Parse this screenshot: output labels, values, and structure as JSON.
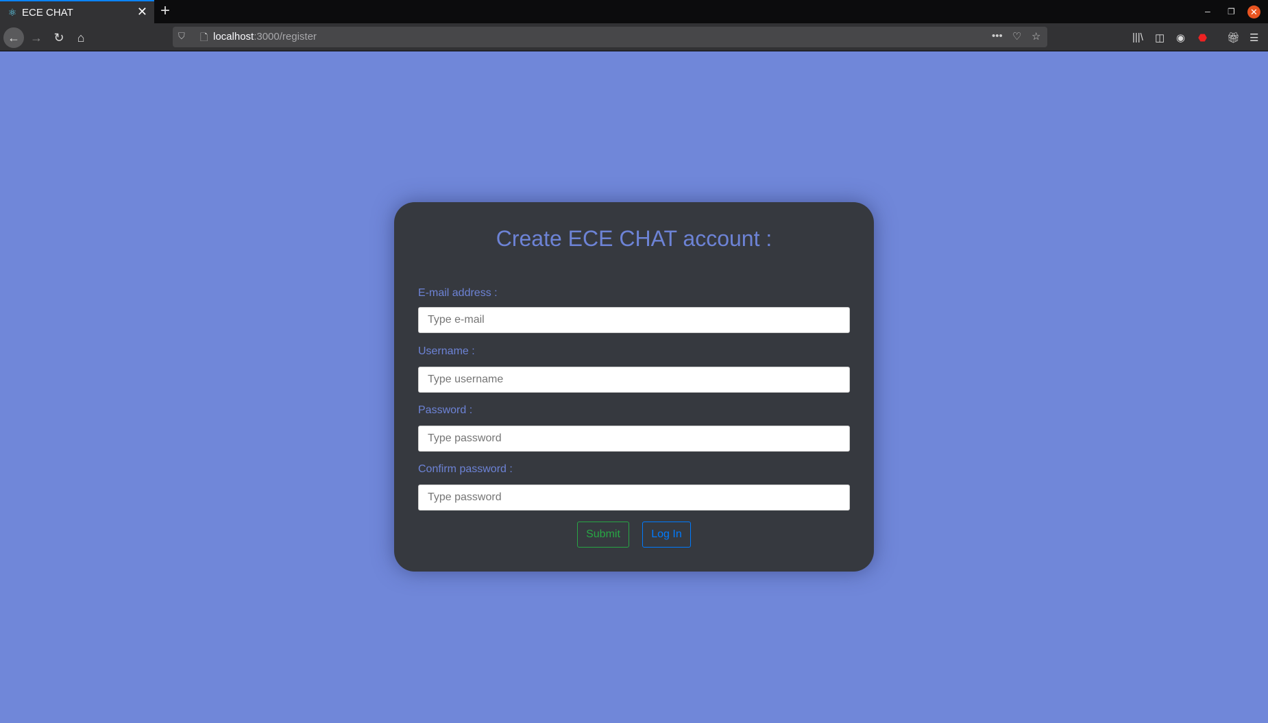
{
  "browser": {
    "tab_title": "ECE CHAT",
    "url_host": "localhost",
    "url_path": ":3000/register"
  },
  "form": {
    "title": "Create ECE CHAT account :",
    "fields": [
      {
        "label": "E-mail address :",
        "placeholder": "Type e-mail",
        "value": ""
      },
      {
        "label": "Username :",
        "placeholder": "Type username",
        "value": ""
      },
      {
        "label": "Password :",
        "placeholder": "Type password",
        "value": ""
      },
      {
        "label": "Confirm password :",
        "placeholder": "Type password",
        "value": ""
      }
    ],
    "submit_label": "Submit",
    "login_label": "Log In"
  },
  "colors": {
    "background": "#7087d9",
    "card": "#36393f",
    "accent": "#6d83d6",
    "submit": "#28a745",
    "login": "#007bff"
  }
}
